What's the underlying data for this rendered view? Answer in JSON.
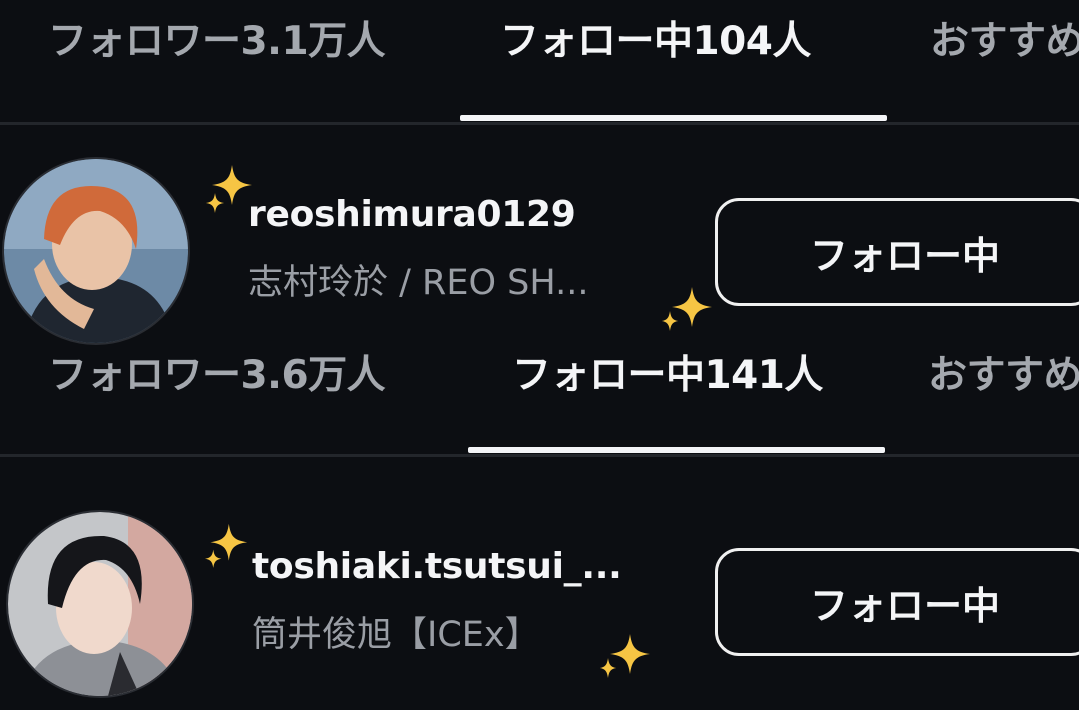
{
  "panels": [
    {
      "tabs": {
        "followers": "フォロワー3.1万人",
        "following": "フォロー中104人",
        "suggested": "おすすめ"
      },
      "user": {
        "username": "reoshimura0129",
        "fullname": "志村玲於 / REO SH...",
        "follow_button": "フォロー中"
      }
    },
    {
      "tabs": {
        "followers": "フォロワー3.6万人",
        "following": "フォロー中141人",
        "suggested": "おすすめ"
      },
      "user": {
        "username": "toshiaki.tsutsui_...",
        "fullname": "筒井俊旭【ICEx】",
        "follow_button": "フォロー中"
      }
    }
  ],
  "colors": {
    "background": "#0c0e12",
    "text_primary": "#f4f5f7",
    "text_secondary": "#9a9ea5",
    "sparkle": "#f6c544"
  },
  "icons": {
    "sparkle": "sparkles-icon",
    "avatar": "profile-photo"
  }
}
